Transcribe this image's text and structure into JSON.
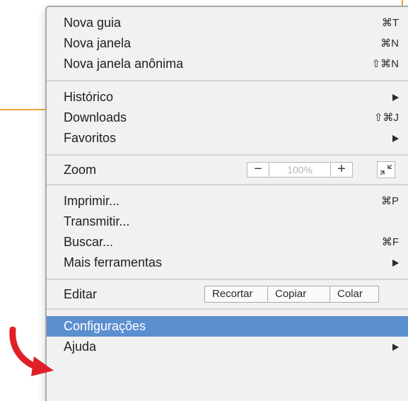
{
  "menu": {
    "section1": [
      {
        "label": "Nova guia",
        "shortcut": "⌘T"
      },
      {
        "label": "Nova janela",
        "shortcut": "⌘N"
      },
      {
        "label": "Nova janela anônima",
        "shortcut": "⇧⌘N"
      }
    ],
    "section2": [
      {
        "label": "Histórico",
        "submenu": true
      },
      {
        "label": "Downloads",
        "shortcut": "⇧⌘J"
      },
      {
        "label": "Favoritos",
        "submenu": true
      }
    ],
    "zoom": {
      "label": "Zoom",
      "minus": "−",
      "value": "100%",
      "plus": "+"
    },
    "section4": [
      {
        "label": "Imprimir...",
        "shortcut": "⌘P"
      },
      {
        "label": "Transmitir..."
      },
      {
        "label": "Buscar...",
        "shortcut": "⌘F"
      },
      {
        "label": "Mais ferramentas",
        "submenu": true
      }
    ],
    "edit": {
      "label": "Editar",
      "cut": "Recortar",
      "copy": "Copiar",
      "paste": "Colar"
    },
    "section6": [
      {
        "label": "Configurações",
        "highlighted": true
      },
      {
        "label": "Ajuda",
        "submenu": true
      }
    ]
  },
  "colors": {
    "highlight": "#5b8fd0",
    "annotation_line": "#f2a341",
    "annotation_arrow": "#e02027"
  },
  "icons": {
    "fullscreen": "fullscreen-icon",
    "submenu": "submenu-arrow-icon",
    "pointer": "red-pointer-arrow-icon"
  }
}
